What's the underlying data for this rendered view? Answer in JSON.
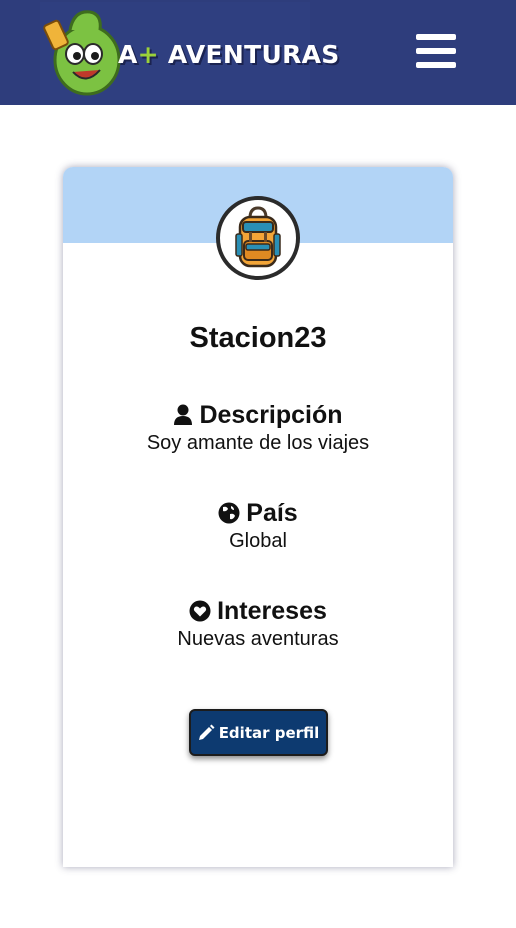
{
  "header": {
    "brand_prefix": "A",
    "brand_plus": "+",
    "brand_name": " AVENTURAS",
    "menu_icon": "hamburger-menu-icon",
    "background_color": "#2e3d7c"
  },
  "profile": {
    "username": "Stacion23",
    "avatar_icon": "backpack-icon",
    "band_color": "#b2d4f6",
    "sections": [
      {
        "icon": "user-icon",
        "title": "Descripción",
        "value": "Soy amante de los viajes"
      },
      {
        "icon": "globe-icon",
        "title": "País",
        "value": "Global"
      },
      {
        "icon": "heart-icon",
        "title": "Intereses",
        "value": "Nuevas aventuras"
      }
    ],
    "edit_button": {
      "icon": "pencil-icon",
      "label": "Editar perfil",
      "color": "#0d3a70"
    }
  }
}
